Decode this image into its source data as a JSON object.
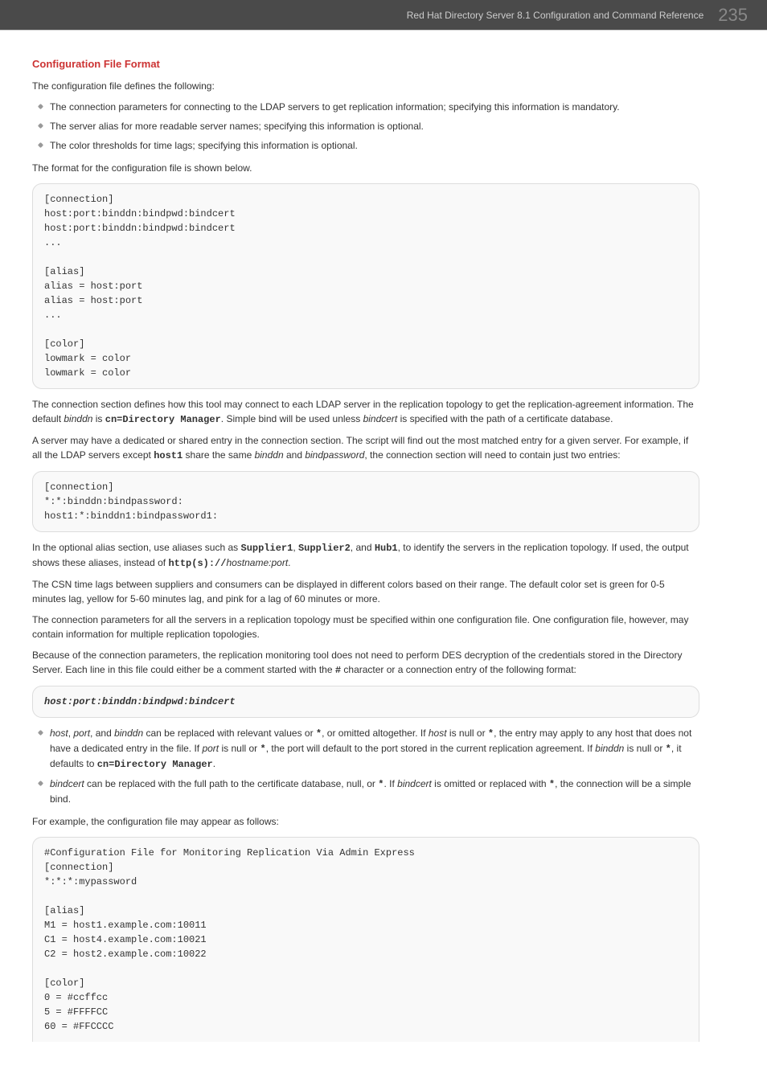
{
  "header": {
    "doc_title": "Red Hat Directory Server 8.1 Configuration and Command Reference",
    "page_number": "235"
  },
  "section_title": "Configuration File Format",
  "intro": "The configuration file defines the following:",
  "defines": [
    "The connection parameters for connecting to the LDAP servers to get replication information; specifying this information is mandatory.",
    "The server alias for more readable server names; specifying this information is optional.",
    "The color thresholds for time lags; specifying this information is optional."
  ],
  "format_lead": "The format for the configuration file is shown below.",
  "code_format": "[connection]\nhost:port:binddn:bindpwd:bindcert\nhost:port:binddn:bindpwd:bindcert\n...\n\n[alias]\nalias = host:port\nalias = host:port\n...\n\n[color]\nlowmark = color\nlowmark = color",
  "para_conn_1a": "The connection section defines how this tool may connect to each LDAP server in the replication topology to get the replication-agreement information. The default ",
  "para_conn_1_binddn": "binddn",
  "para_conn_1_is": " is ",
  "para_conn_1_cn": "cn=Directory Manager",
  "para_conn_1b": ". Simple bind will be used unless ",
  "para_conn_1_bindcert": "bindcert",
  "para_conn_1c": " is specified with the path of a certificate database.",
  "para_conn_2a": "A server may have a dedicated or shared entry in the connection section. The script will find out the most matched entry for a given server. For example, if all the LDAP servers except ",
  "para_conn_2_host1": "host1",
  "para_conn_2b": " share the same ",
  "para_conn_2_binddn": "binddn",
  "para_conn_2_and": " and ",
  "para_conn_2_bindpwd": "bindpassword",
  "para_conn_2c": ", the connection section will need to contain just two entries:",
  "code_conn2": "[connection]\n*:*:binddn:bindpassword:\nhost1:*:binddn1:bindpassword1:",
  "para_alias_a": "In the optional alias section, use aliases such as ",
  "alias_s1": "Supplier1",
  "alias_comma1": ", ",
  "alias_s2": "Supplier2",
  "alias_comma2": ", and ",
  "alias_hub1": "Hub1",
  "para_alias_b": ", to identify the servers in the replication topology. If used, the output shows these aliases, instead of ",
  "alias_http": "http(s)://",
  "alias_hostport": "hostname:port",
  "alias_period": ".",
  "para_csn": "The CSN time lags between suppliers and consumers can be displayed in different colors based on their range. The default color set is green for 0-5 minutes lag, yellow for 5-60 minutes lag, and pink for a lag of 60 minutes or more.",
  "para_multi": "The connection parameters for all the servers in a replication topology must be specified within one configuration file. One configuration file, however, may contain information for multiple replication topologies.",
  "para_des_a": "Because of the connection parameters, the replication monitoring tool does not need to perform DES decryption of the credentials stored in the Directory Server. Each line in this file could either be a comment started with the ",
  "hash_char": "#",
  "para_des_b": " character or a connection entry of the following format:",
  "code_hostline": "host:port:binddn:bindpwd:bindcert",
  "bullet2_1_a": "host",
  "bullet2_1_b": ", ",
  "bullet2_1_c": "port",
  "bullet2_1_d": ", and ",
  "bullet2_1_e": "binddn",
  "bullet2_1_f": " can be replaced with relevant values or ",
  "star": "*",
  "bullet2_1_g": ", or omitted altogether. If ",
  "bullet2_1_h": "host",
  "bullet2_1_i": " is null or ",
  "bullet2_1_j": ", the entry may apply to any host that does not have a dedicated entry in the file. If ",
  "bullet2_1_k": "port",
  "bullet2_1_l": " is null or ",
  "bullet2_1_m": ", the port will default to the port stored in the current replication agreement. If ",
  "bullet2_1_n": "binddn",
  "bullet2_1_o": " is null or ",
  "bullet2_1_p": ", it defaults to ",
  "bullet2_1_q": "cn=Directory Manager",
  "bullet2_1_r": ".",
  "bullet2_2_a": "bindcert",
  "bullet2_2_b": " can be replaced with the full path to the certificate database, null, or ",
  "bullet2_2_c": ". If ",
  "bullet2_2_d": "bindcert",
  "bullet2_2_e": " is omitted or replaced with ",
  "bullet2_2_f": ", the connection will be a simple bind.",
  "para_example": "For example, the configuration file may appear as follows:",
  "code_example": "#Configuration File for Monitoring Replication Via Admin Express\n[connection]\n*:*:*:mypassword\n\n[alias]\nM1 = host1.example.com:10011\nC1 = host4.example.com:10021\nC2 = host2.example.com:10022\n\n[color]\n0 = #ccffcc\n5 = #FFFFCC\n60 = #FFCCCC"
}
